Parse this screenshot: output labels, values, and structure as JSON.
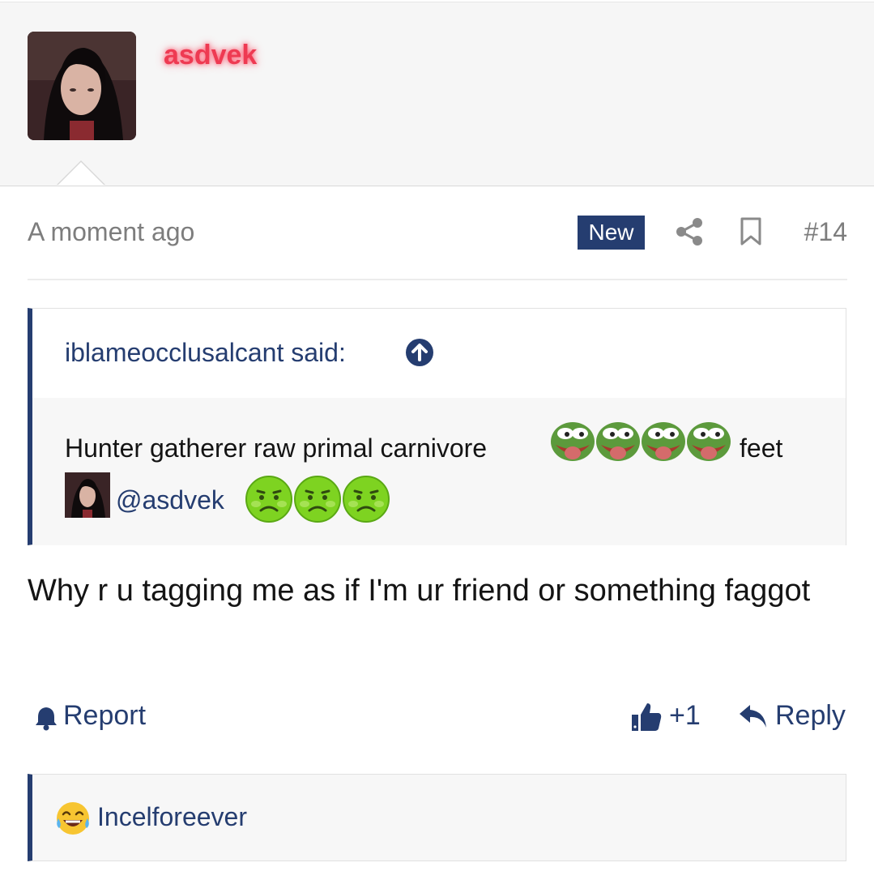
{
  "post": {
    "author": "asdvek",
    "timestamp": "A moment ago",
    "badge": "New",
    "number": "#14",
    "message": "Why r u tagging me as if I'm ur friend or something faggot"
  },
  "quote": {
    "attribution": "iblameocclusalcant said:",
    "text_part1": "Hunter gatherer raw primal carnivore",
    "text_part2": "feet",
    "mention": "@asdvek",
    "pepe_count": 4,
    "sick_count": 3
  },
  "actions": {
    "report_label": "Report",
    "like_count": "+1",
    "reply_label": "Reply"
  },
  "reactions": {
    "user": "Incelforeever"
  },
  "colors": {
    "accent": "#253d70",
    "username": "#ee3a52",
    "muted": "#7d7d7d"
  },
  "icons": [
    "share-icon",
    "bookmark-icon",
    "arrow-up-circle-icon",
    "bell-icon",
    "thumbs-up-icon",
    "reply-icon",
    "laughing-emoji-icon",
    "pepe-emoji-icon",
    "sick-emoji-icon"
  ]
}
